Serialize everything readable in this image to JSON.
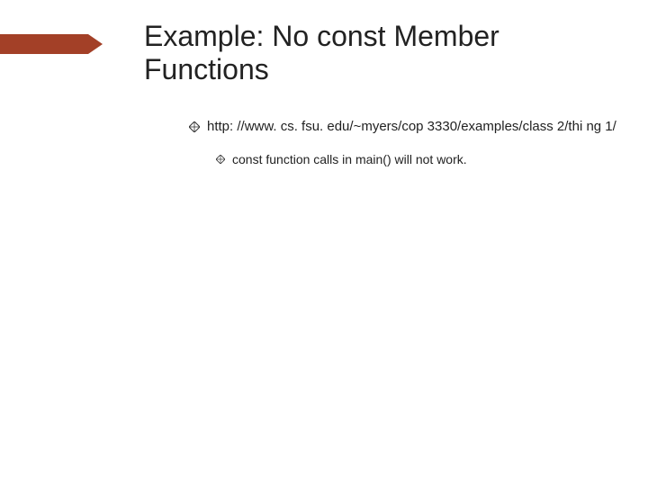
{
  "accent_color": "#a34027",
  "title": "Example:  No const Member Functions",
  "bullets": [
    {
      "text": "http: //www. cs. fsu. edu/~myers/cop 3330/examples/class 2/thi ng 1/",
      "children": [
        {
          "text": "const function calls in main() will not work."
        }
      ]
    }
  ]
}
